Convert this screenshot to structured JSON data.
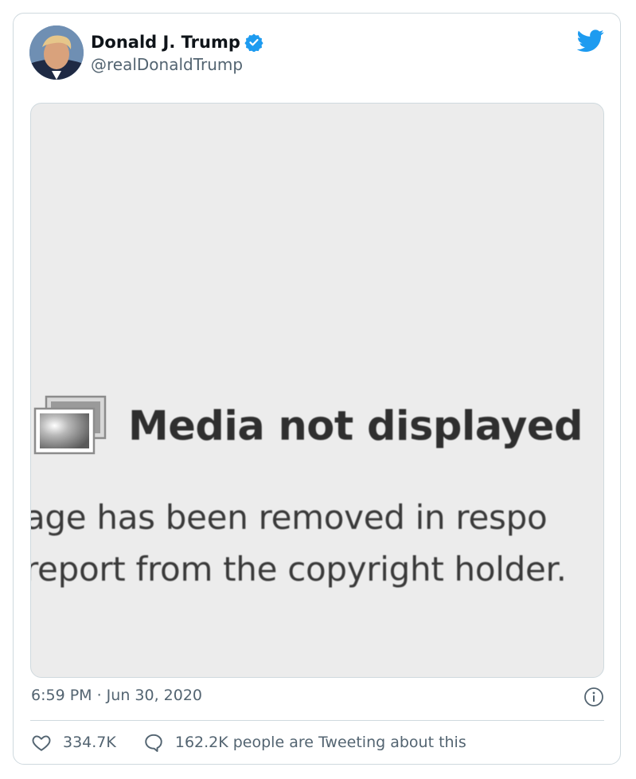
{
  "tweet": {
    "author": {
      "display_name": "Donald J. Trump",
      "handle": "@realDonaldTrump",
      "verified": true,
      "avatar_icon": "profile-photo"
    },
    "media": {
      "title": "Media not displayed",
      "line1": "age has been removed in respo",
      "line2": "report from the copyright holder."
    },
    "timestamp": "6:59 PM · Jun 30, 2020",
    "likes": "334.7K",
    "conversation": "162.2K people are Tweeting about this"
  },
  "icons": {
    "brand": "twitter-bird-icon",
    "info": "info-icon",
    "like": "heart-icon",
    "reply": "comment-bubble-icon"
  },
  "colors": {
    "twitter_blue": "#1d9bf0",
    "secondary_text": "#536471",
    "border": "#cfd9de",
    "media_bg": "#ececec"
  }
}
